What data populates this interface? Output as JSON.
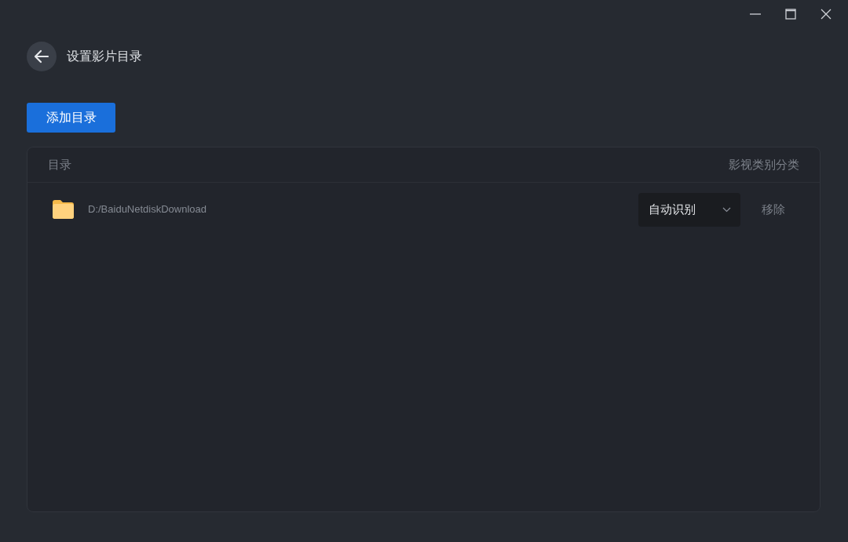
{
  "header": {
    "title": "设置影片目录"
  },
  "add_button": "添加目录",
  "table": {
    "columns": [
      "目录",
      "影视类别分类"
    ],
    "rows": [
      {
        "path": "D:/BaiduNetdiskDownload",
        "category": "自动识别",
        "action": "移除"
      }
    ]
  }
}
